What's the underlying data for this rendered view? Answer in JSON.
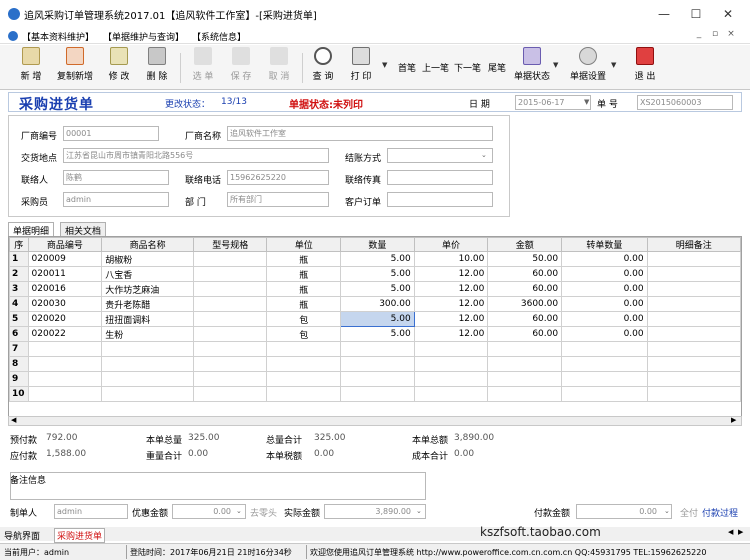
{
  "window": {
    "title": "追风采购订单管理系统2017.01【追风软件工作室】-[采购进货单]",
    "min": "—",
    "max": "☐",
    "close": "✕"
  },
  "menu": {
    "items": [
      "【基本资料维护】",
      "【单据维护与查询】",
      "【系统信息】"
    ],
    "mdi": [
      "_",
      "▫",
      "×"
    ]
  },
  "toolbar": {
    "new": "新 增",
    "copy_new": "复制新增",
    "edit": "修 改",
    "delete": "删 除",
    "select": "选 单",
    "save": "保 存",
    "cancel": "取 消",
    "query": "查 询",
    "print": "打 印",
    "first": "首笔",
    "prev": "上一笔",
    "next": "下一笔",
    "last": "尾笔",
    "doc_status": "单据状态",
    "doc_settings": "单据设置",
    "exit": "退 出"
  },
  "header": {
    "form_title": "采购进货单",
    "change_status_label": "更改状态：",
    "change_status_value": "13/13",
    "doc_status": "单据状态:未列印",
    "date_label": "日  期",
    "date_value": "2015-06-17",
    "docno_label": "单  号",
    "docno_value": "XS2015060003"
  },
  "form": {
    "vendor_code_label": "厂商编号",
    "vendor_code": "00001",
    "vendor_name_label": "厂商名称",
    "vendor_name": "追风软件工作室",
    "address_label": "交货地点",
    "address": "江苏省昆山市周市镇青阳北路556号",
    "settle_label": "结账方式",
    "settle_value": "",
    "contact_label": "联络人",
    "contact": "陈鹤",
    "phone_label": "联络电话",
    "phone": "15962625220",
    "fax_label": "联络传真",
    "fax": "",
    "buyer_label": "采购员",
    "buyer": "admin",
    "dept_label": "部  门",
    "dept": "所有部门",
    "custorder_label": "客户订单",
    "custorder": ""
  },
  "tabs": [
    "单据明细",
    "相关文档"
  ],
  "grid": {
    "columns": [
      "序",
      "商品编号",
      "商品名称",
      "型号规格",
      "单位",
      "数量",
      "单价",
      "金额",
      "转单数量",
      "明细备注"
    ],
    "rows": [
      [
        "1",
        "020009",
        "胡椒粉",
        "",
        "瓶",
        "5.00",
        "10.00",
        "50.00",
        "0.00",
        ""
      ],
      [
        "2",
        "020011",
        "八宝香",
        "",
        "瓶",
        "5.00",
        "12.00",
        "60.00",
        "0.00",
        ""
      ],
      [
        "3",
        "020016",
        "大作坊芝麻油",
        "",
        "瓶",
        "5.00",
        "12.00",
        "60.00",
        "0.00",
        ""
      ],
      [
        "4",
        "020030",
        "贵升老陈醋",
        "",
        "瓶",
        "300.00",
        "12.00",
        "3600.00",
        "0.00",
        ""
      ],
      [
        "5",
        "020020",
        "扭扭面调料",
        "",
        "包",
        "5.00",
        "12.00",
        "60.00",
        "0.00",
        ""
      ],
      [
        "6",
        "020022",
        "生粉",
        "",
        "包",
        "5.00",
        "12.00",
        "60.00",
        "0.00",
        ""
      ],
      [
        "7",
        "",
        "",
        "",
        "",
        "",
        "",
        "",
        "",
        ""
      ],
      [
        "8",
        "",
        "",
        "",
        "",
        "",
        "",
        "",
        "",
        ""
      ],
      [
        "9",
        "",
        "",
        "",
        "",
        "",
        "",
        "",
        "",
        ""
      ],
      [
        "10",
        "",
        "",
        "",
        "",
        "",
        "",
        "",
        "",
        ""
      ]
    ]
  },
  "summary": {
    "prepay_label": "预付款",
    "prepay": "792.00",
    "unit_total_label": "本单总量",
    "unit_total": "325.00",
    "qty_total_label": "总量合计",
    "qty_total": "325.00",
    "amount_total_label": "本单总额",
    "amount_total": "3,890.00",
    "payable_label": "应付款",
    "payable": "1,588.00",
    "weight_total_label": "重量合计",
    "weight_total": "0.00",
    "tax_label": "本单税额",
    "tax": "0.00",
    "cost_total_label": "成本合计",
    "cost_total": "0.00"
  },
  "remarks_label": "备注信息",
  "bottom": {
    "maker_label": "制单人",
    "maker": "admin",
    "discount_label": "优惠金额",
    "discount": "0.00",
    "zero_label": "去零头",
    "actual_label": "实际金额",
    "actual": "3,890.00",
    "paid_label": "付款金额",
    "paid": "0.00",
    "full_label": "全付",
    "process_label": "付款过程"
  },
  "bottom_tabs": [
    "导航界面",
    "采购进货单"
  ],
  "watermark": "kszfsoft.taobao.com",
  "status": {
    "user": "当前用户：admin",
    "login": "登陆时间：2017年06月21日 21时16分34秒",
    "welcome": "欢迎您使用追风订单管理系统 http://www.poweroffice.com.cn.com.cn QQ:45931795 TEL:15962625220"
  }
}
